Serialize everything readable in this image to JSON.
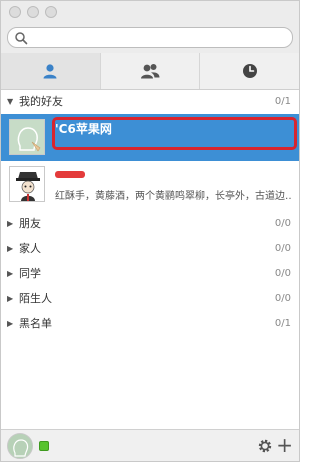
{
  "window": {
    "controls": [
      "close",
      "minimize",
      "zoom"
    ]
  },
  "search": {
    "value": "",
    "placeholder": ""
  },
  "tabs": [
    {
      "id": "contacts",
      "icon": "person-icon",
      "active": true
    },
    {
      "id": "groups",
      "icon": "people-icon",
      "active": false
    },
    {
      "id": "recent",
      "icon": "clock-icon",
      "active": false
    }
  ],
  "groups": [
    {
      "label": "我的好友",
      "count": "0/1",
      "expanded": true
    },
    {
      "label": "朋友",
      "count": "0/0",
      "expanded": false
    },
    {
      "label": "家人",
      "count": "0/0",
      "expanded": false
    },
    {
      "label": "同学",
      "count": "0/0",
      "expanded": false
    },
    {
      "label": "陌生人",
      "count": "0/0",
      "expanded": false
    },
    {
      "label": "黑名单",
      "count": "0/1",
      "expanded": false
    }
  ],
  "contacts": [
    {
      "name": "'C6苹果网",
      "signature": "",
      "selected": true
    },
    {
      "name": "",
      "signature": "红酥手，黄藤酒，两个黄鹂鸣翠柳，长亭外，古道边…",
      "selected": false
    }
  ],
  "colors": {
    "selection": "#3d8fd5",
    "highlight_box": "#d8252e",
    "status_online": "#57c32e",
    "tab_icon": "#3a82c8"
  }
}
